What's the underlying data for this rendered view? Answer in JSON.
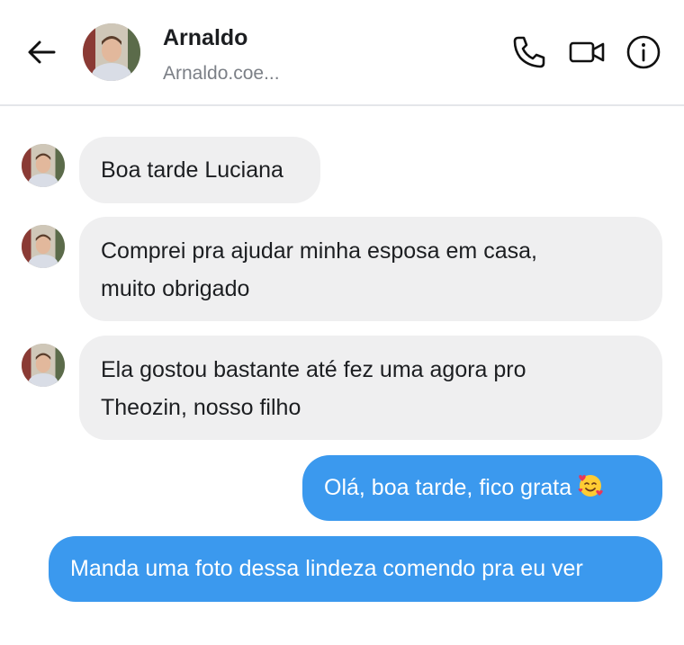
{
  "header": {
    "name": "Arnaldo",
    "handle": "Arnaldo.coe..."
  },
  "messages": [
    {
      "direction": "incoming",
      "text": "Boa tarde Luciana"
    },
    {
      "direction": "incoming",
      "text_lines": [
        "Comprei pra ajudar minha esposa em casa,",
        "muito obrigado"
      ]
    },
    {
      "direction": "incoming",
      "text_lines": [
        "Ela gostou bastante até fez uma agora pro",
        "Theozin, nosso filho"
      ]
    },
    {
      "direction": "outgoing",
      "text": "Olá, boa tarde, fico grata",
      "emoji": "smiling-face-with-hearts"
    },
    {
      "direction": "outgoing",
      "text": "Manda uma foto dessa lindeza comendo pra eu ver"
    }
  ],
  "colors": {
    "outgoing_bubble": "#3b99ee",
    "incoming_bubble": "#efeff0",
    "handle_text": "#7b7f86"
  },
  "icons": [
    "back-arrow-icon",
    "phone-icon",
    "video-camera-icon",
    "info-icon"
  ]
}
